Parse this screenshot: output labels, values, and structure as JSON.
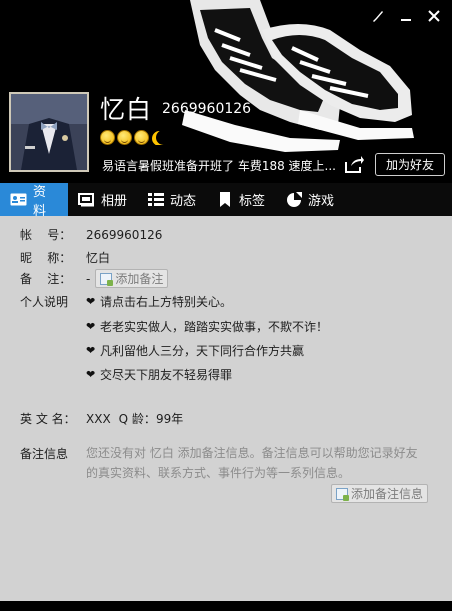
{
  "window": {
    "controls": [
      "skin-icon",
      "minimize-icon",
      "close-icon"
    ]
  },
  "header": {
    "nickname": "忆白",
    "qq_number": "2669960126",
    "level_icons": [
      "sun-icon",
      "sun-icon",
      "sun-icon",
      "moon-icon"
    ],
    "signature": "易语言暑假班准备开班了 车费188  速度上...",
    "add_friend_label": "加为好友"
  },
  "tabs": [
    {
      "label": "资料",
      "icon": "profile-card-icon",
      "active": true
    },
    {
      "label": "相册",
      "icon": "photo-album-icon",
      "active": false
    },
    {
      "label": "动态",
      "icon": "feed-list-icon",
      "active": false
    },
    {
      "label": "标签",
      "icon": "bookmark-icon",
      "active": false
    },
    {
      "label": "游戏",
      "icon": "game-icon",
      "active": false
    }
  ],
  "profile": {
    "account_label": "帐    号：",
    "account_value": "2669960126",
    "nickname_label": "昵    称：",
    "nickname_value": "忆白",
    "remark_label": "备    注：",
    "remark_value": "-",
    "add_remark_label": "添加备注",
    "intro_label": "个人说明",
    "intro_lines": [
      "请点击右上方特别关心。",
      "老老实实做人，踏踏实实做事，不欺不诈！",
      "凡利留他人三分，天下同行合作方共赢",
      "交尽天下朋友不轻易得罪"
    ],
    "english_name_label": "英 文 名：",
    "english_name_value": "XXX",
    "qage_label": "Q 龄：",
    "qage_value": "99年",
    "memo_label": "备注信息",
    "memo_text": "您还没有对 忆白 添加备注信息。备注信息可以帮助您记录好友的真实资料、联系方式、事件行为等一系列信息。",
    "add_memo_label": "添加备注信息"
  },
  "colors": {
    "tab_active": "#2a89d8",
    "content_bg": "#d2d2d2",
    "header_bg": "#000000"
  }
}
